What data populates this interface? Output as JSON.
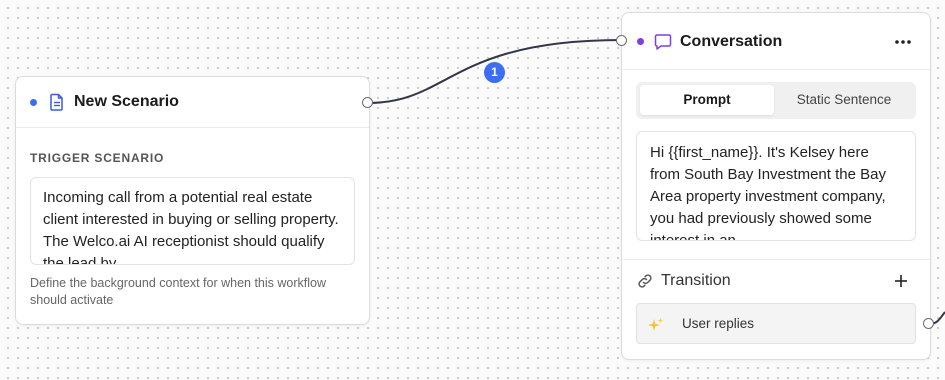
{
  "scenario_node": {
    "title": "New Scenario",
    "section_label": "TRIGGER SCENARIO",
    "scenario_text": "Incoming call from a potential real estate client interested in buying or selling property. The Welco.ai AI receptionist should qualify the lead by",
    "helper_text": "Define the background context for when this workflow should activate",
    "status_color": "#3b6ef0",
    "icon": "document-icon"
  },
  "edge": {
    "badge": "1"
  },
  "conversation_node": {
    "title": "Conversation",
    "status_color": "#7b3fe4",
    "icon": "chat-bubble-icon",
    "menu_icon": "more-horizontal-icon",
    "tabs": [
      {
        "label": "Prompt",
        "active": true
      },
      {
        "label": "Static Sentence",
        "active": false
      }
    ],
    "prompt_text": "Hi {{first_name}}. It's Kelsey here from South Bay Investment the Bay Area property investment company, you had previously showed some interest in an",
    "transition": {
      "label": "Transition",
      "icon": "link-icon",
      "add_icon": "plus-icon",
      "items": [
        {
          "label": "User replies",
          "icon": "sparkles-icon"
        }
      ]
    }
  }
}
